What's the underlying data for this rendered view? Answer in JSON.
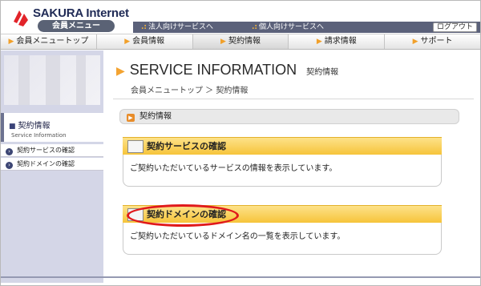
{
  "header": {
    "logo_title": "SAKURA Internet",
    "logo_subtitle": "会員メニュー",
    "links": [
      {
        "label": "法人向けサービスへ"
      },
      {
        "label": "個人向けサービスへ"
      }
    ],
    "logout_label": "ログアウト"
  },
  "tabs": [
    {
      "label": "会員メニュートップ"
    },
    {
      "label": "会員情報"
    },
    {
      "label": "契約情報"
    },
    {
      "label": "請求情報"
    },
    {
      "label": "サポート"
    }
  ],
  "sidebar": {
    "title": "契約情報",
    "subtitle": "Service Information",
    "items": [
      {
        "label": "契約サービスの確認"
      },
      {
        "label": "契約ドメインの確認"
      }
    ]
  },
  "main": {
    "title": "SERVICE INFORMATION",
    "title_sub": "契約情報",
    "breadcrumb": "会員メニュートップ ＞ 契約情報",
    "section_title": "契約情報",
    "cards": [
      {
        "title": "契約サービスの確認",
        "body": "ご契約いただいているサービスの情報を表示しています。"
      },
      {
        "title": "契約ドメインの確認",
        "body": "ご契約いただいているドメイン名の一覧を表示しています。"
      }
    ]
  },
  "colors": {
    "accent_orange": "#f3a331",
    "nav_dark": "#5b617a",
    "highlight_red": "#e0191b"
  }
}
